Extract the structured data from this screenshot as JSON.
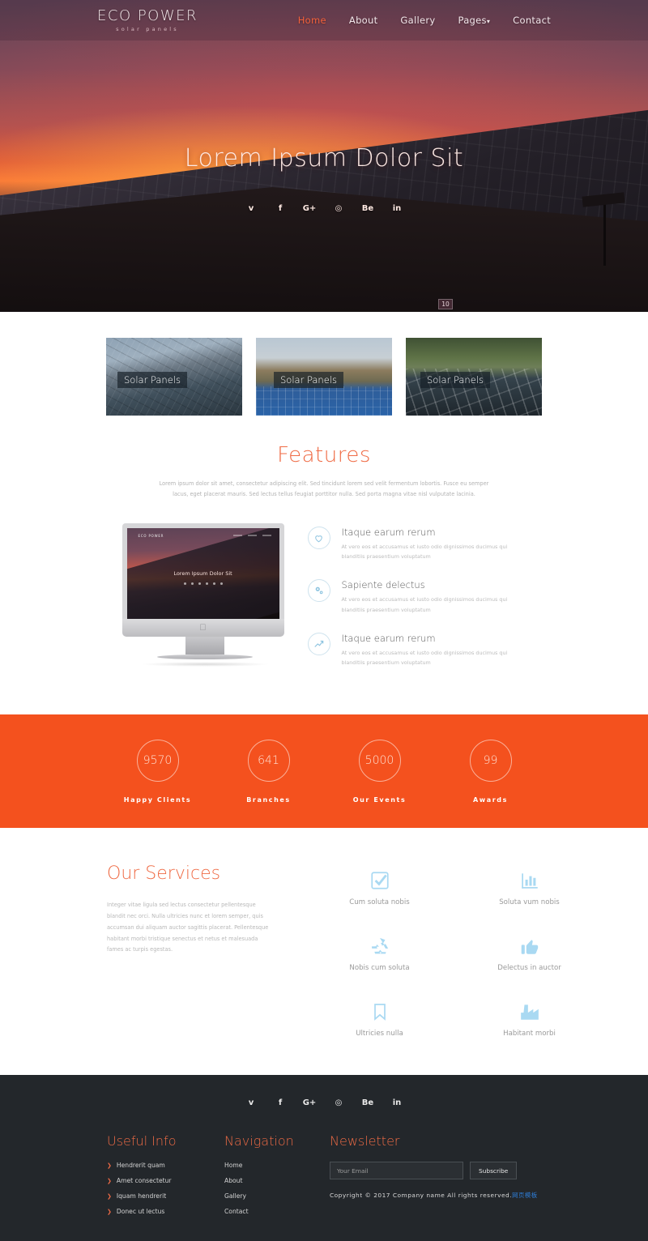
{
  "header": {
    "logo_main": "ECO POWER",
    "logo_sub": "solar panels",
    "nav": [
      {
        "label": "Home",
        "active": true
      },
      {
        "label": "About",
        "active": false
      },
      {
        "label": "Gallery",
        "active": false
      },
      {
        "label": "Pages",
        "active": false,
        "caret": "▾"
      },
      {
        "label": "Contact",
        "active": false
      }
    ]
  },
  "hero": {
    "title": "Lorem Ipsum Dolor Sit",
    "badge": "10",
    "social": [
      {
        "name": "twitter-icon",
        "glyph": "ᴠ"
      },
      {
        "name": "facebook-icon",
        "glyph": "f"
      },
      {
        "name": "google-plus-icon",
        "glyph": "G+"
      },
      {
        "name": "dribbble-icon",
        "glyph": "◎"
      },
      {
        "name": "behance-icon",
        "glyph": "Be"
      },
      {
        "name": "linkedin-icon",
        "glyph": "in"
      }
    ]
  },
  "cards": [
    {
      "label": "Solar Panels"
    },
    {
      "label": "Solar Panels"
    },
    {
      "label": "Solar Panels"
    }
  ],
  "features": {
    "title": "Features",
    "description": "Lorem ipsum dolor sit amet, consectetur adipiscing elit. Sed tincidunt lorem sed velit fermentum lobortis. Fusce eu semper lacus, eget placerat mauris. Sed lectus tellus feugiat porttitor nulla. Sed porta magna vitae nisl vulputate lacinia.",
    "mockup": {
      "logo": "ECO POWER",
      "hero_text": "Lorem Ipsum Dolor Sit"
    },
    "items": [
      {
        "icon": "heart-icon",
        "title": "Itaque earum rerum",
        "text": "At vero eos et accusamus et iusto odio dignissimos ducimus qui blanditiis praesentium voluptatum"
      },
      {
        "icon": "cogs-icon",
        "title": "Sapiente delectus",
        "text": "At vero eos et accusamus et iusto odio dignissimos ducimus qui blanditiis praesentium voluptatum"
      },
      {
        "icon": "chart-line-icon",
        "title": "Itaque earum rerum",
        "text": "At vero eos et accusamus et iusto odio dignissimos ducimus qui blanditiis praesentium voluptatum"
      }
    ]
  },
  "stats": {
    "accent_color": "#f4511e",
    "items": [
      {
        "value": "9570",
        "label": "Happy Clients"
      },
      {
        "value": "641",
        "label": "Branches"
      },
      {
        "value": "5000",
        "label": "Our Events"
      },
      {
        "value": "99",
        "label": "Awards"
      }
    ]
  },
  "services": {
    "title": "Our Services",
    "description": "Integer vitae ligula sed lectus consectetur pellentesque blandit nec orci. Nulla ultricies nunc et lorem semper, quis accumsan dui aliquam auctor sagittis placerat. Pellentesque habitant morbi tristique senectus et netus et malesuada fames ac turpis egestas.",
    "items": [
      {
        "icon": "check-square-icon",
        "label": "Cum soluta nobis"
      },
      {
        "icon": "bar-chart-icon",
        "label": "Soluta vum nobis"
      },
      {
        "icon": "recycle-icon",
        "label": "Nobis cum soluta"
      },
      {
        "icon": "thumbs-up-icon",
        "label": "Delectus in auctor"
      },
      {
        "icon": "bookmark-icon",
        "label": "Ultricies nulla"
      },
      {
        "icon": "factory-icon",
        "label": "Habitant morbi"
      }
    ]
  },
  "footer": {
    "social": [
      {
        "name": "twitter-icon",
        "glyph": "ᴠ"
      },
      {
        "name": "facebook-icon",
        "glyph": "f"
      },
      {
        "name": "google-plus-icon",
        "glyph": "G+"
      },
      {
        "name": "dribbble-icon",
        "glyph": "◎"
      },
      {
        "name": "behance-icon",
        "glyph": "Be"
      },
      {
        "name": "linkedin-icon",
        "glyph": "in"
      }
    ],
    "useful_info": {
      "title": "Useful Info",
      "items": [
        "Hendrerit quam",
        "Amet consectetur",
        "Iquam hendrerit",
        "Donec ut lectus"
      ]
    },
    "navigation": {
      "title": "Navigation",
      "items": [
        "Home",
        "About",
        "Gallery",
        "Contact"
      ]
    },
    "newsletter": {
      "title": "Newsletter",
      "placeholder": "Your Email",
      "value": "",
      "button": "Subscribe",
      "copyright": "Copyright © 2017 Company name All rights reserved.",
      "credit_link": "网页模板"
    }
  }
}
